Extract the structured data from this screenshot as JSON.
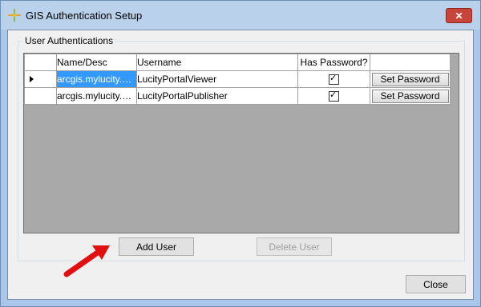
{
  "window": {
    "title": "GIS Authentication Setup",
    "close_glyph": "✕"
  },
  "group": {
    "label": "User Authentications"
  },
  "grid": {
    "columns": [
      "",
      "Name/Desc",
      "Username",
      "Has Password?",
      ""
    ],
    "rows": [
      {
        "name": "arcgis.mylucity.vi...",
        "username": "LucityPortalViewer",
        "has_password": true,
        "button": "Set Password",
        "current": true
      },
      {
        "name": "arcgis.mylucity.pu...",
        "username": "LucityPortalPublisher",
        "has_password": true,
        "button": "Set Password",
        "current": false
      }
    ]
  },
  "buttons": {
    "add_user": "Add User",
    "delete_user": "Delete User",
    "close": "Close"
  },
  "colors": {
    "accent_selection": "#3399ff",
    "annotation_arrow": "#e01010"
  }
}
